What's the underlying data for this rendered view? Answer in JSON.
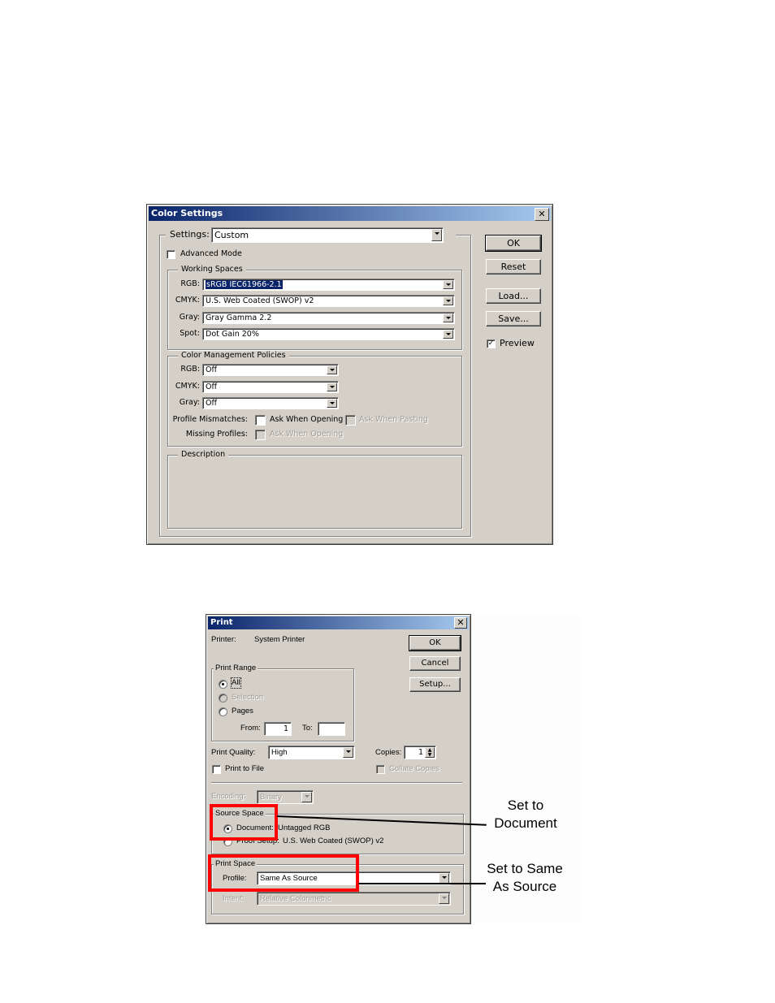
{
  "color_settings": {
    "title": "Color Settings",
    "settings_label": "Settings:",
    "settings_value": "Custom",
    "advanced_mode_label": "Advanced Mode",
    "advanced_mode_checked": false,
    "working_spaces": {
      "title": "Working Spaces",
      "rows": [
        {
          "label": "RGB:",
          "value": "sRGB IEC61966-2.1",
          "selected": true
        },
        {
          "label": "CMYK:",
          "value": "U.S. Web Coated (SWOP) v2"
        },
        {
          "label": "Gray:",
          "value": "Gray Gamma 2.2"
        },
        {
          "label": "Spot:",
          "value": "Dot Gain 20%"
        }
      ]
    },
    "policies": {
      "title": "Color Management Policies",
      "rows": [
        {
          "label": "RGB:",
          "value": "Off"
        },
        {
          "label": "CMYK:",
          "value": "Off"
        },
        {
          "label": "Gray:",
          "value": "Off"
        }
      ],
      "profile_mismatches_label": "Profile Mismatches:",
      "ask_when_opening": "Ask When Opening",
      "ask_when_pasting": "Ask When Pasting",
      "missing_profiles_label": "Missing Profiles:",
      "missing_ask_when_opening": "Ask When Opening"
    },
    "description": {
      "title": "Description",
      "text": ""
    },
    "buttons": {
      "ok": "OK",
      "reset": "Reset",
      "load": "Load...",
      "save": "Save..."
    },
    "preview_label": "Preview",
    "preview_checked": true
  },
  "print": {
    "title": "Print",
    "printer_label": "Printer:",
    "printer_value": "System Printer",
    "buttons": {
      "ok": "OK",
      "cancel": "Cancel",
      "setup": "Setup..."
    },
    "print_range": {
      "title": "Print Range",
      "all": "All",
      "selection": "Selection",
      "pages": "Pages",
      "from_label": "From:",
      "from_value": "1",
      "to_label": "To:",
      "to_value": ""
    },
    "print_quality_label": "Print Quality:",
    "print_quality_value": "High",
    "copies_label": "Copies:",
    "copies_value": "1",
    "print_to_file": "Print to File",
    "collate_copies": "Collate Copies",
    "encoding_label": "Encoding:",
    "encoding_value": "Binary",
    "source_space": {
      "title": "Source Space",
      "document_label": "Document:",
      "document_value": "Untagged RGB",
      "proof_label": "Proof Setup:",
      "proof_value": "U.S. Web Coated (SWOP) v2"
    },
    "print_space": {
      "title": "Print Space",
      "profile_label": "Profile:",
      "profile_value": "Same As Source",
      "intent_label": "Intent:",
      "intent_value": "Relative Colorimetric"
    }
  },
  "annotations": {
    "highlight_color": "#ff0000",
    "source_callout": "Set to Document",
    "print_callout": "Set to Same As Source"
  }
}
